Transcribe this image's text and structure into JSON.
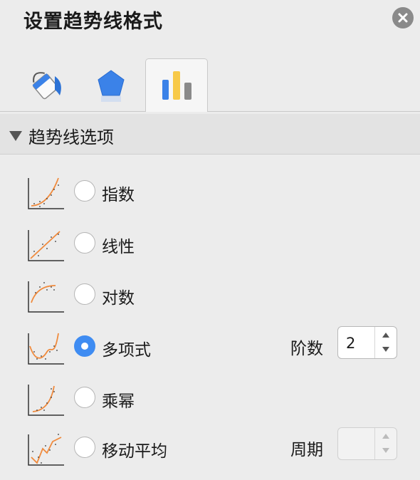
{
  "panel": {
    "title": "设置趋势线格式"
  },
  "tabs": [
    {
      "name": "paint-bucket-icon"
    },
    {
      "name": "pentagon-icon"
    },
    {
      "name": "bar-chart-icon",
      "active": true
    }
  ],
  "section": {
    "label": "趋势线选项"
  },
  "options": [
    {
      "label": "指数",
      "icon": "exponential-trend-icon",
      "checked": false
    },
    {
      "label": "线性",
      "icon": "linear-trend-icon",
      "checked": false
    },
    {
      "label": "对数",
      "icon": "logarithmic-trend-icon",
      "checked": false
    },
    {
      "label": "多项式",
      "icon": "polynomial-trend-icon",
      "checked": true
    },
    {
      "label": "乘幂",
      "icon": "power-trend-icon",
      "checked": false
    },
    {
      "label": "移动平均",
      "icon": "moving-average-trend-icon",
      "checked": false
    }
  ],
  "order": {
    "label": "阶数",
    "value": "2"
  },
  "period": {
    "label": "周期",
    "value": ""
  },
  "colors": {
    "accent": "#3f8cf2",
    "trendline": "#f08a3c"
  }
}
